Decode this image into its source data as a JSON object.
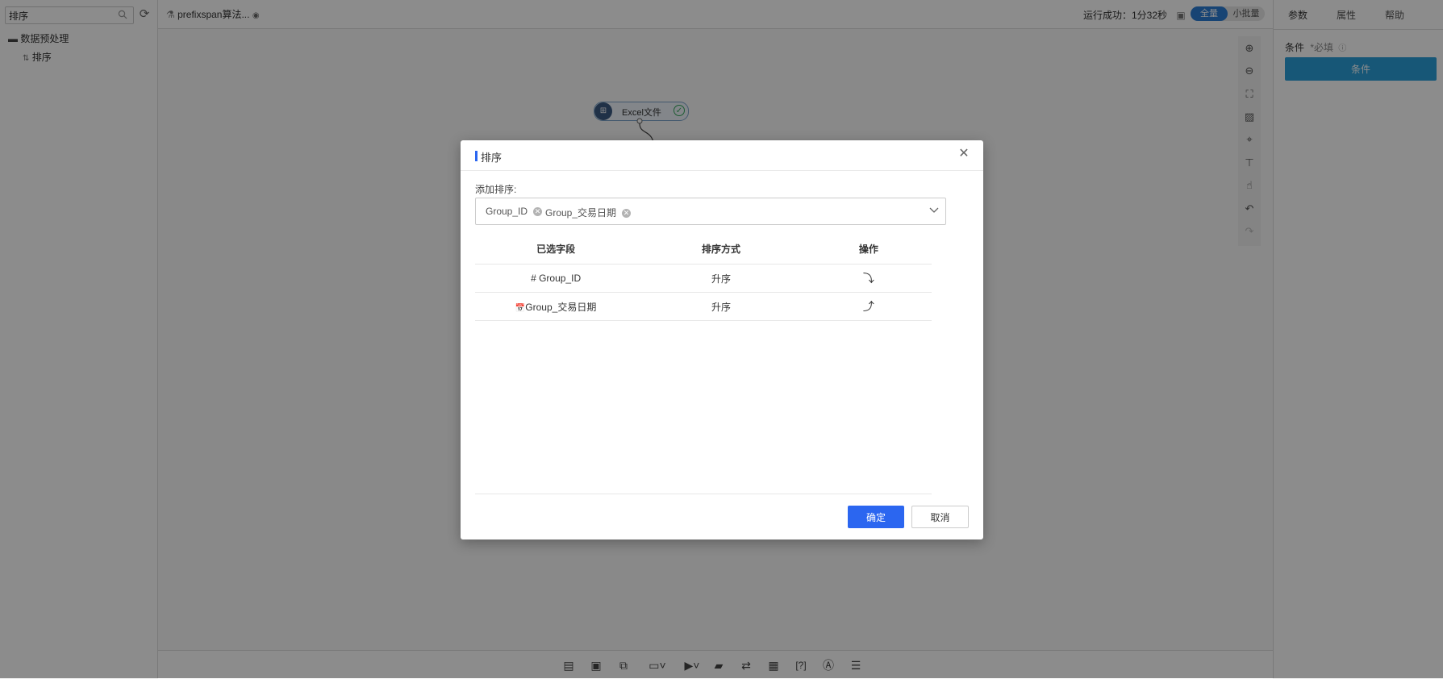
{
  "left_panel": {
    "search_value": "排序",
    "tree": {
      "folder_label": "数据预处理",
      "item_label": "排序"
    }
  },
  "topbar": {
    "tab_title": "prefixspan算法...",
    "run_status": "运行成功：1分32秒",
    "toggle_on": "全量",
    "toggle_off": "小批量"
  },
  "canvas": {
    "node_label": "Excel文件"
  },
  "right_panel": {
    "tabs": [
      "参数",
      "属性",
      "帮助"
    ],
    "condition_label": "条件",
    "condition_required": "*必填",
    "condition_button": "条件"
  },
  "dialog": {
    "title": "排序",
    "add_label": "添加排序:",
    "chips": [
      "Group_ID",
      "Group_交易日期"
    ],
    "columns": [
      "已选字段",
      "排序方式",
      "操作"
    ],
    "rows": [
      {
        "field": "Group_ID",
        "order": "升序",
        "icon": "hash-icon"
      },
      {
        "field": "Group_交易日期",
        "order": "升序",
        "icon": "calendar-icon"
      }
    ],
    "ok_label": "确定",
    "cancel_label": "取消"
  }
}
